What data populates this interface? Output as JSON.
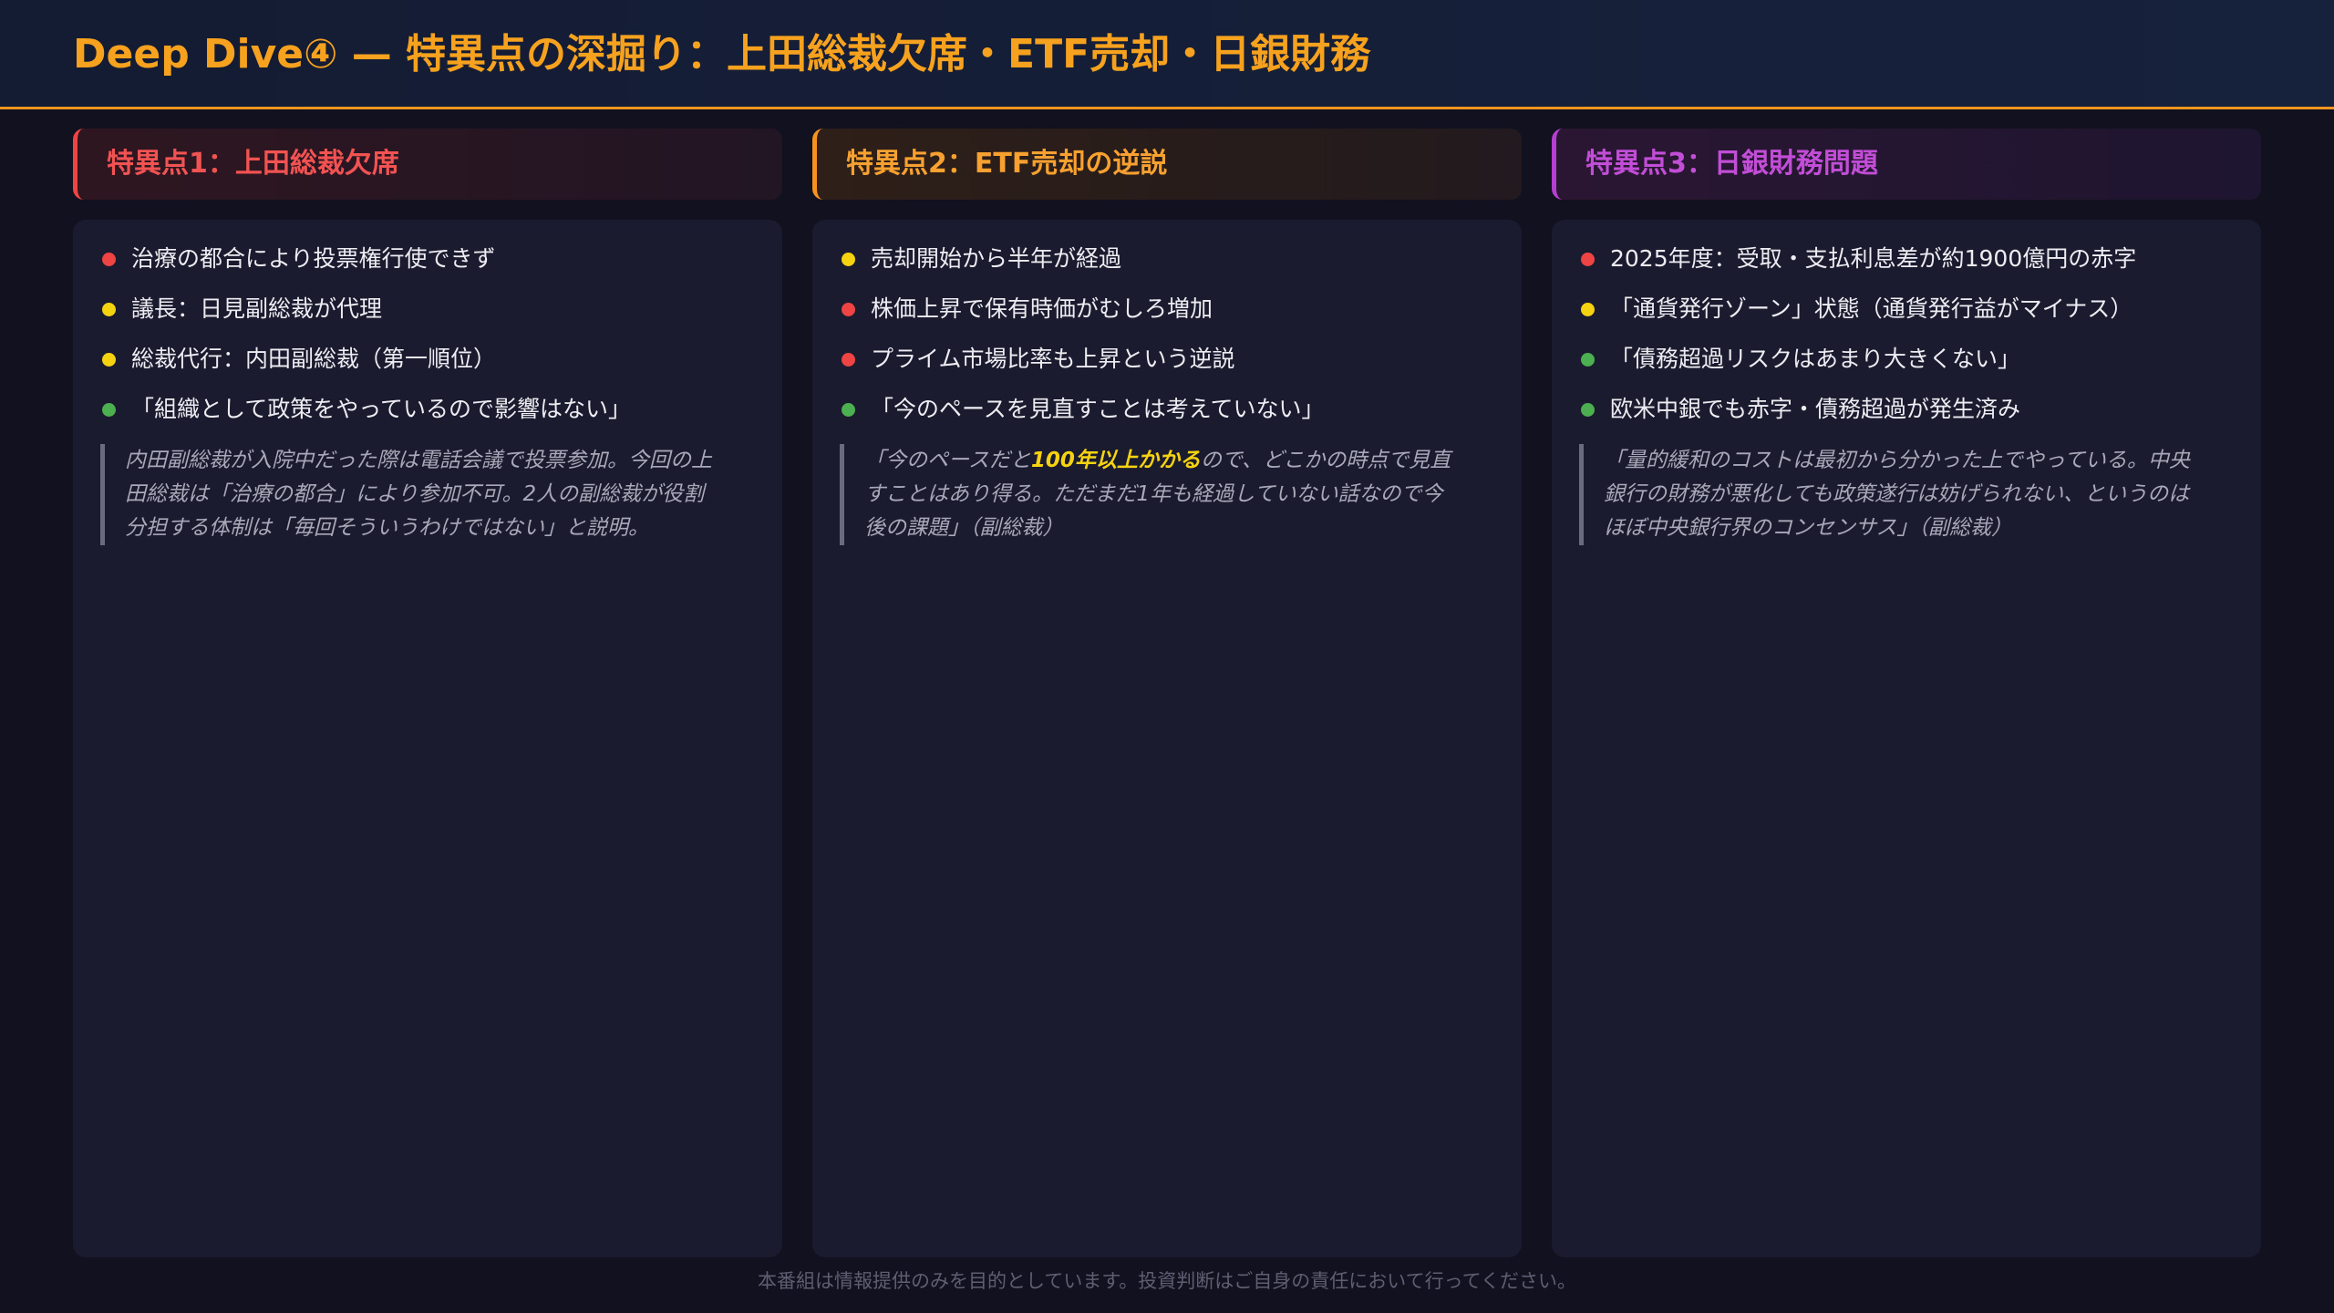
{
  "header": {
    "title": "Deep Dive④ — 特異点の深掘り：上田総裁欠席・ETF売却・日銀財務"
  },
  "columns": [
    {
      "title": "特異点1：上田総裁欠席",
      "accent": "#ef4444",
      "bullets": [
        {
          "text": "治療の都合により投票権行使できず",
          "color": "red"
        },
        {
          "text": "議長：日見副総裁が代理",
          "color": "yellow"
        },
        {
          "text": "総裁代行：内田副総裁（第一順位）",
          "color": "yellow"
        },
        {
          "text": "「組織として政策をやっているので影響はない」",
          "color": "green"
        }
      ],
      "quote": {
        "before": "内田副総裁が入院中だった際は電話会議で投票参加。今回の上田総裁は「治療の都合」により参加不可。2人の副総裁が役割分担する体制は「毎回そういうわけではない」と説明。",
        "highlight": "",
        "after": ""
      }
    },
    {
      "title": "特異点2：ETF売却の逆説",
      "accent": "#f5931e",
      "bullets": [
        {
          "text": "売却開始から半年が経過",
          "color": "yellow"
        },
        {
          "text": "株価上昇で保有時価がむしろ増加",
          "color": "red"
        },
        {
          "text": "プライム市場比率も上昇という逆説",
          "color": "red"
        },
        {
          "text": "「今のペースを見直すことは考えていない」",
          "color": "green"
        }
      ],
      "quote": {
        "before": "「今のペースだと",
        "highlight": "100年以上かかる",
        "after": "ので、どこかの時点で見直すことはあり得る。ただまだ1年も経過していない話なので今後の課題」（副総裁）"
      }
    },
    {
      "title": "特異点3：日銀財務問題",
      "accent": "#b63fd0",
      "bullets": [
        {
          "text": "2025年度：受取・支払利息差が約1900億円の赤字",
          "color": "red"
        },
        {
          "text": "「通貨発行ゾーン」状態（通貨発行益がマイナス）",
          "color": "yellow"
        },
        {
          "text": "「債務超過リスクはあまり大きくない」",
          "color": "green"
        },
        {
          "text": "欧米中銀でも赤字・債務超過が発生済み",
          "color": "green"
        }
      ],
      "quote": {
        "before": "「量的緩和のコストは最初から分かった上でやっている。中央銀行の財務が悪化しても政策遂行は妨げられない、というのはほぼ中央銀行界のコンセンサス」（副総裁）",
        "highlight": "",
        "after": ""
      }
    }
  ],
  "footer": {
    "disclaimer": "本番組は情報提供のみを目的としています。投資判断はご自身の責任において行ってください。"
  },
  "colors": {
    "red": "#ef4444",
    "yellow": "#f5d311",
    "green": "#4caf50",
    "title_orange": "#f7a21f"
  }
}
